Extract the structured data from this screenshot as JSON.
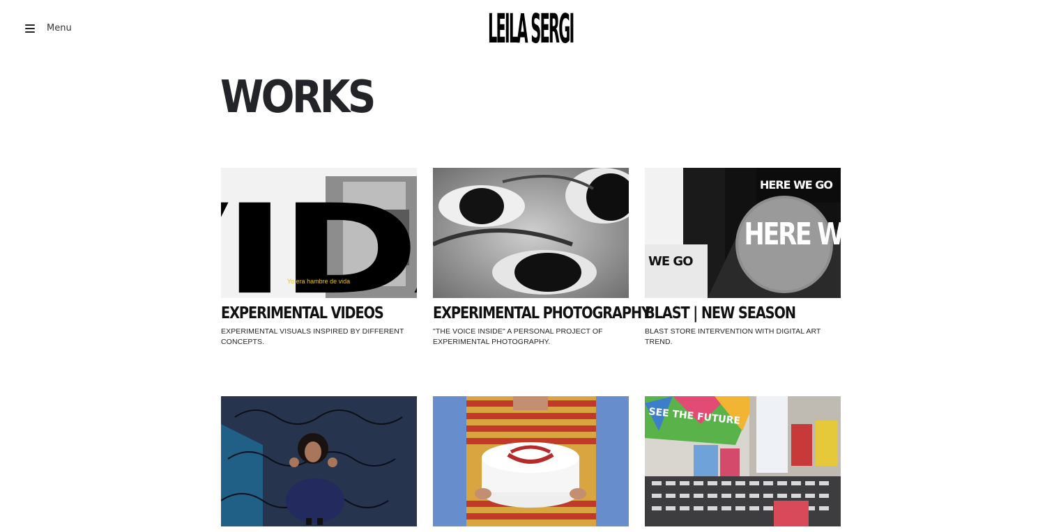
{
  "header": {
    "menu_label": "Menu",
    "menu_icon": "hamburger-icon",
    "logo_text": "LEILA SERGI"
  },
  "page": {
    "title": "WORKS"
  },
  "projects": [
    {
      "title": "EXPERIMENTAL VIDEOS",
      "description": "EXPERIMENTAL VISUALS INSPIRED BY DIFFERENT CONCEPTS.",
      "thumb_text": "VIDA",
      "thumb_caption": "Yo era hambre de vida"
    },
    {
      "title": "EXPERIMENTAL PHOTOGRAPHY",
      "description": "\"THE VOICE INSIDE\" A PERSONAL PROJECT OF EXPERIMENTAL PHOTOGRAPHY."
    },
    {
      "title": "BLAST | NEW SEASON",
      "description": "BLAST STORE INTERVENTION WITH DIGITAL ART TREND.",
      "thumb_text": "HERE WE GO"
    },
    {
      "title": "",
      "description": ""
    },
    {
      "title": "",
      "description": ""
    },
    {
      "title": "",
      "description": "",
      "thumb_text": "SEE THE FUTURE"
    }
  ]
}
